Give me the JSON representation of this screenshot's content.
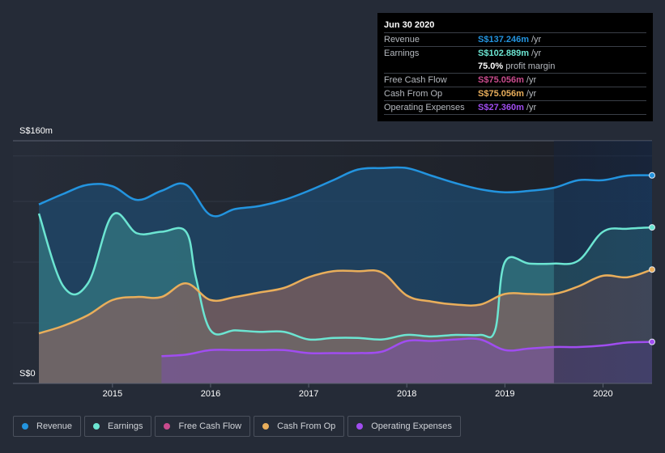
{
  "tooltip": {
    "date": "Jun 30 2020",
    "rows": [
      {
        "label": "Revenue",
        "value": "S$137.246m",
        "unit": "/yr",
        "color": "#2394df"
      },
      {
        "label": "Earnings",
        "value": "S$102.889m",
        "unit": "/yr",
        "color": "#6ce5d2"
      },
      {
        "label": "",
        "value": "75.0%",
        "unit": "profit margin",
        "color": "#ffffff"
      },
      {
        "label": "Free Cash Flow",
        "value": "S$75.056m",
        "unit": "/yr",
        "color": "#c94b8d"
      },
      {
        "label": "Cash From Op",
        "value": "S$75.056m",
        "unit": "/yr",
        "color": "#e9ae5b"
      },
      {
        "label": "Operating Expenses",
        "value": "S$27.360m",
        "unit": "/yr",
        "color": "#a04df0"
      }
    ]
  },
  "legend": [
    {
      "label": "Revenue",
      "color": "#2394df"
    },
    {
      "label": "Earnings",
      "color": "#6ce5d2"
    },
    {
      "label": "Free Cash Flow",
      "color": "#c94b8d"
    },
    {
      "label": "Cash From Op",
      "color": "#e9ae5b"
    },
    {
      "label": "Operating Expenses",
      "color": "#a04df0"
    }
  ],
  "chart_data": {
    "type": "area",
    "title": "",
    "xlabel": "",
    "ylabel": "",
    "y_tick_labels": [
      "S$0",
      "S$160m"
    ],
    "ylim": [
      0,
      160
    ],
    "xlim": [
      2014.25,
      2020.5
    ],
    "x_tick_labels": [
      "2015",
      "2016",
      "2017",
      "2018",
      "2019",
      "2020"
    ],
    "x_ticks": [
      2015,
      2016,
      2017,
      2018,
      2019,
      2020
    ],
    "grid": true,
    "legend_position": "bottom",
    "highlight_start": 2019.5,
    "series": [
      {
        "name": "Revenue",
        "color": "#2394df",
        "x": [
          2014.25,
          2014.5,
          2014.75,
          2015.0,
          2015.25,
          2015.5,
          2015.75,
          2016.0,
          2016.25,
          2016.5,
          2016.75,
          2017.0,
          2017.25,
          2017.5,
          2017.75,
          2018.0,
          2018.25,
          2018.5,
          2018.75,
          2019.0,
          2019.25,
          2019.5,
          2019.75,
          2020.0,
          2020.25,
          2020.5
        ],
        "values": [
          118,
          125,
          131,
          130,
          121,
          127,
          131,
          111,
          115,
          117,
          121,
          127,
          134,
          141,
          142,
          142,
          137,
          132,
          128,
          126,
          127,
          129,
          134,
          134,
          137,
          137.2
        ]
      },
      {
        "name": "Earnings",
        "color": "#6ce5d2",
        "x": [
          2014.25,
          2014.5,
          2014.75,
          2015.0,
          2015.25,
          2015.5,
          2015.75,
          2015.85,
          2016.0,
          2016.25,
          2016.5,
          2016.75,
          2017.0,
          2017.25,
          2017.5,
          2017.75,
          2018.0,
          2018.25,
          2018.5,
          2018.75,
          2018.9,
          2019.0,
          2019.25,
          2019.5,
          2019.75,
          2020.0,
          2020.25,
          2020.5
        ],
        "values": [
          112,
          64,
          66,
          111,
          99,
          100,
          100,
          70,
          35,
          35,
          34,
          34,
          29,
          30,
          30,
          29,
          32,
          31,
          32,
          32,
          35,
          80,
          79,
          79,
          81,
          100,
          102,
          102.9
        ]
      },
      {
        "name": "Free Cash Flow",
        "color": "#c94b8d",
        "x": [
          2014.25,
          2014.5,
          2014.75,
          2015.0,
          2015.25,
          2015.5,
          2015.75,
          2016.0,
          2016.25,
          2016.5,
          2016.75,
          2017.0,
          2017.25,
          2017.5,
          2017.75,
          2018.0,
          2018.25,
          2018.5,
          2018.75,
          2019.0,
          2019.25,
          2019.5,
          2019.75,
          2020.0,
          2020.25,
          2020.5
        ],
        "values": [
          33,
          38,
          45,
          55,
          57,
          57,
          66,
          55,
          57,
          60,
          63,
          70,
          74,
          74,
          73,
          58,
          54,
          52,
          52,
          59,
          59,
          59,
          64,
          71,
          70,
          75.1
        ]
      },
      {
        "name": "Cash From Op",
        "color": "#e9ae5b",
        "x": [
          2014.25,
          2014.5,
          2014.75,
          2015.0,
          2015.25,
          2015.5,
          2015.75,
          2016.0,
          2016.25,
          2016.5,
          2016.75,
          2017.0,
          2017.25,
          2017.5,
          2017.75,
          2018.0,
          2018.25,
          2018.5,
          2018.75,
          2019.0,
          2019.25,
          2019.5,
          2019.75,
          2020.0,
          2020.25,
          2020.5
        ],
        "values": [
          33,
          38,
          45,
          55,
          57,
          57,
          66,
          55,
          57,
          60,
          63,
          70,
          74,
          74,
          73,
          58,
          54,
          52,
          52,
          59,
          59,
          59,
          64,
          71,
          70,
          75.1
        ]
      },
      {
        "name": "Operating Expenses",
        "color": "#a04df0",
        "x": [
          2015.5,
          2015.75,
          2016.0,
          2016.25,
          2016.5,
          2016.75,
          2017.0,
          2017.25,
          2017.5,
          2017.75,
          2018.0,
          2018.25,
          2018.5,
          2018.75,
          2019.0,
          2019.25,
          2019.5,
          2019.75,
          2020.0,
          2020.25,
          2020.5
        ],
        "values": [
          18,
          19,
          22,
          22,
          22,
          22,
          20,
          20,
          20,
          21,
          28,
          28,
          29,
          29,
          22,
          23,
          24,
          24,
          25,
          27,
          27.4
        ]
      }
    ]
  }
}
